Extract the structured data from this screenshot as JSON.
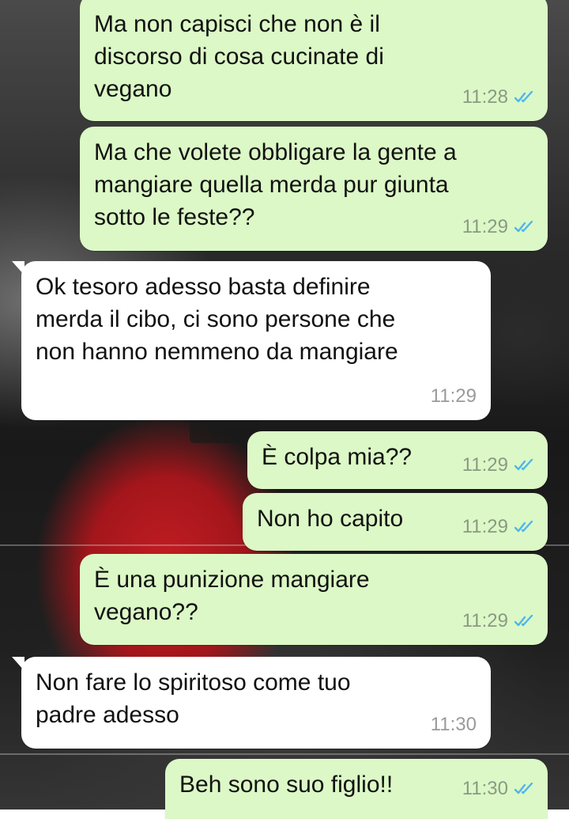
{
  "chat": {
    "messages": [
      {
        "direction": "out",
        "text": "Ma non capisci che non è il\ndiscorso di cosa cucinate di\nvegano",
        "time": "11:28",
        "status": "read"
      },
      {
        "direction": "out",
        "text": "Ma che volete obbligare la gente a\nmangiare quella merda pur giunta\nsotto le feste??",
        "time": "11:29",
        "status": "read"
      },
      {
        "direction": "in",
        "text": "Ok tesoro adesso basta definire\nmerda il cibo, ci sono persone che\nnon hanno nemmeno da mangiare",
        "time": "11:29"
      },
      {
        "direction": "out",
        "text": "È colpa mia??",
        "time": "11:29",
        "status": "read"
      },
      {
        "direction": "out",
        "text": "Non ho capito",
        "time": "11:29",
        "status": "read"
      },
      {
        "direction": "out",
        "text": "È una punizione mangiare\nvegano??",
        "time": "11:29",
        "status": "read"
      },
      {
        "direction": "in",
        "text": "Non fare lo spiritoso come tuo\npadre adesso",
        "time": "11:30"
      },
      {
        "direction": "out",
        "text": "Beh sono suo figlio!!",
        "time": "11:30",
        "status": "read"
      }
    ]
  },
  "colors": {
    "outgoing_bubble": "#dcf8c6",
    "incoming_bubble": "#ffffff",
    "read_ticks": "#4fb6ec"
  },
  "icons": {
    "read_status": "double-check-icon"
  }
}
